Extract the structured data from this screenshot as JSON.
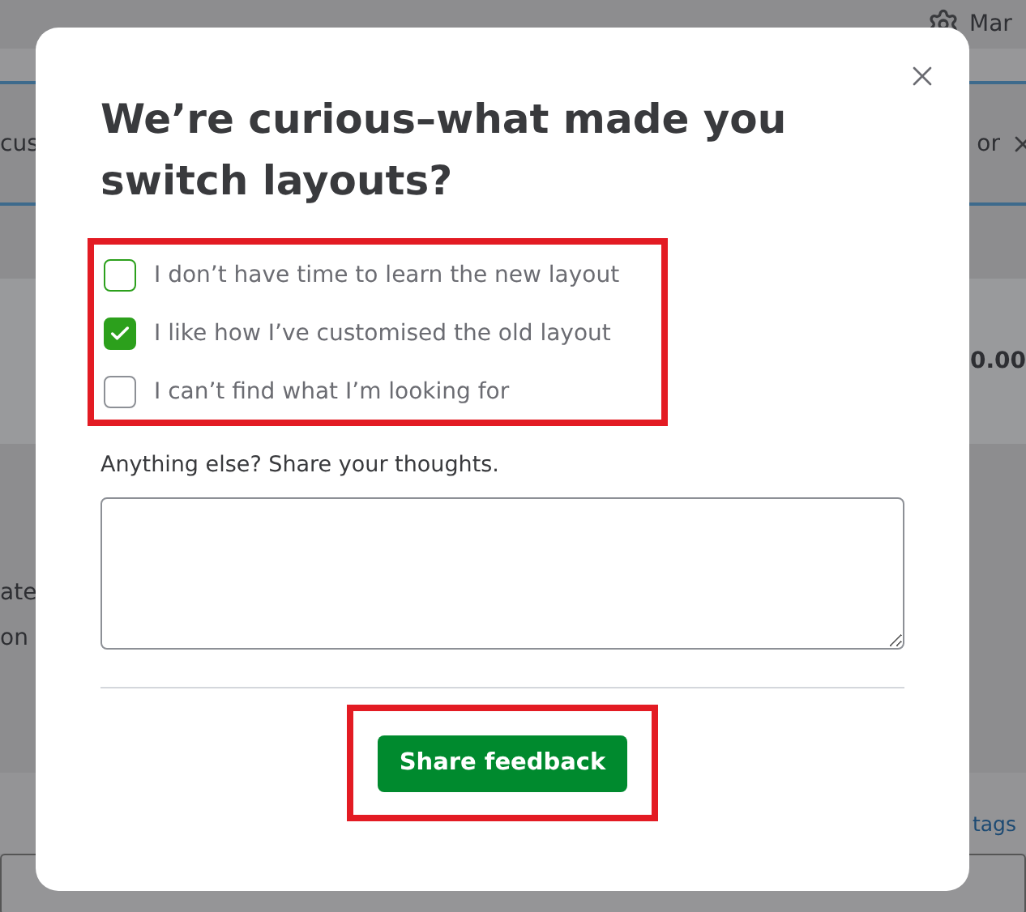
{
  "background": {
    "user_label": "Mar",
    "tab_left": "cus",
    "tab_right": "or",
    "amount": "0.00",
    "lines": [
      "ate",
      "on"
    ],
    "link": "tags"
  },
  "dialog": {
    "title": "We’re curious–what made you switch layouts?",
    "options": [
      {
        "label": "I don’t have time to learn the new layout",
        "checked": false
      },
      {
        "label": "I like how I’ve customised the old layout",
        "checked": true
      },
      {
        "label": "I can’t find what I’m looking for",
        "checked": false
      }
    ],
    "comment_label": "Anything else? Share your thoughts.",
    "submit": "Share feedback"
  }
}
